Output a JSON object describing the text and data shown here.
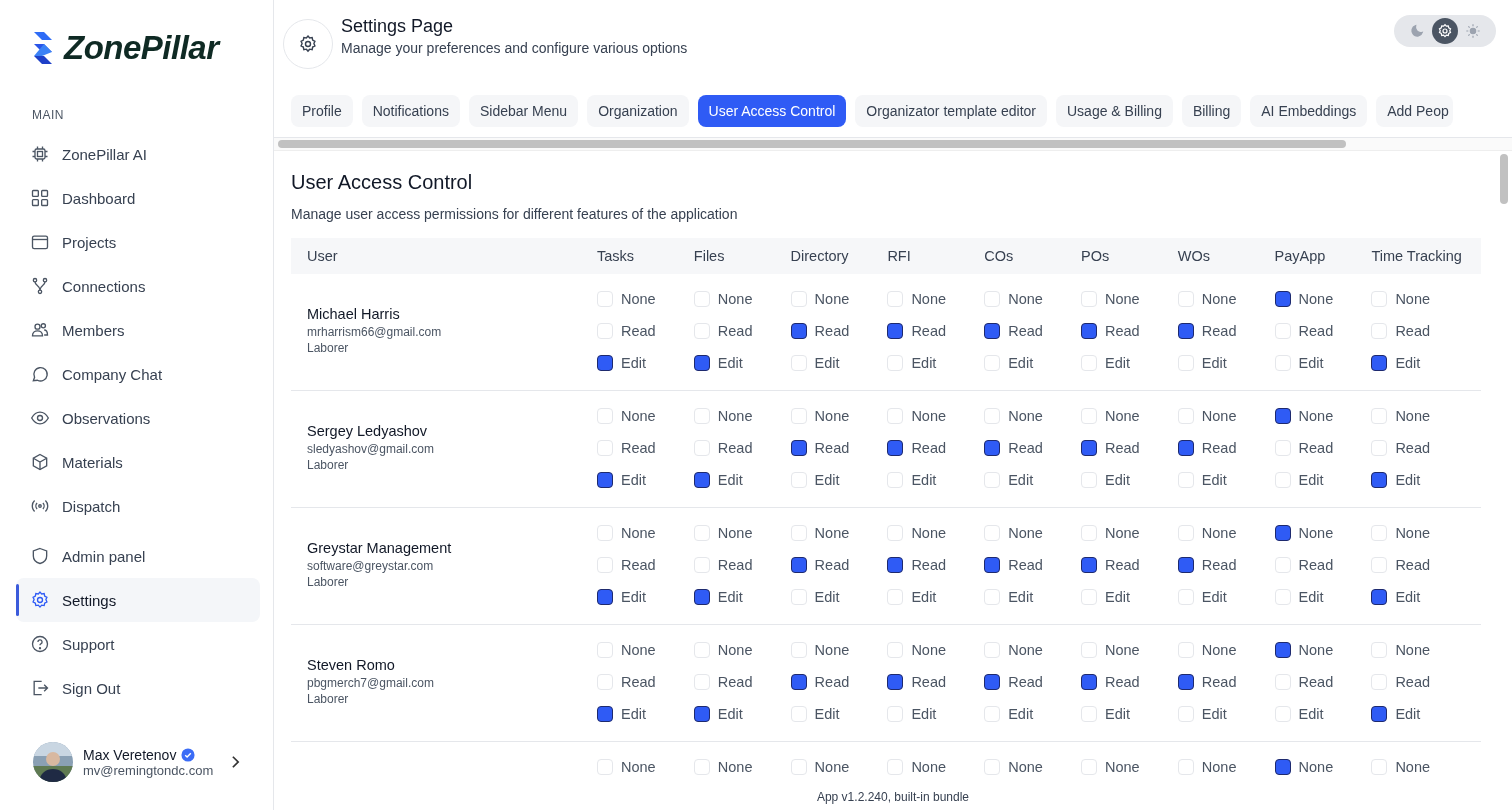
{
  "brand": {
    "name": "ZonePillar"
  },
  "sidebar": {
    "section_label": "MAIN",
    "items": [
      {
        "label": "ZonePillar AI",
        "selected": false
      },
      {
        "label": "Dashboard",
        "selected": false
      },
      {
        "label": "Projects",
        "selected": false
      },
      {
        "label": "Connections",
        "selected": false
      },
      {
        "label": "Members",
        "selected": false
      },
      {
        "label": "Company Chat",
        "selected": false
      },
      {
        "label": "Observations",
        "selected": false
      },
      {
        "label": "Materials",
        "selected": false
      },
      {
        "label": "Dispatch",
        "selected": false
      }
    ],
    "bottom_items": [
      {
        "label": "Admin panel",
        "selected": false
      },
      {
        "label": "Settings",
        "selected": true
      },
      {
        "label": "Support",
        "selected": false
      },
      {
        "label": "Sign Out",
        "selected": false
      }
    ],
    "user": {
      "name": "Max Veretenov",
      "email": "mv@remingtondc.com",
      "verified": true
    }
  },
  "header": {
    "title": "Settings Page",
    "subtitle": "Manage your preferences and configure various options"
  },
  "theme_modes": [
    {
      "kind": "dark",
      "selected": false
    },
    {
      "kind": "system",
      "selected": true
    },
    {
      "kind": "light",
      "selected": false
    }
  ],
  "tabs": [
    {
      "label": "Profile",
      "selected": false
    },
    {
      "label": "Notifications",
      "selected": false
    },
    {
      "label": "Sidebar Menu",
      "selected": false
    },
    {
      "label": "Organization",
      "selected": false
    },
    {
      "label": "User Access Control",
      "selected": true
    },
    {
      "label": "Organizator template editor",
      "selected": false
    },
    {
      "label": "Usage & Billing",
      "selected": false
    },
    {
      "label": "Billing",
      "selected": false
    },
    {
      "label": "AI Embeddings",
      "selected": false
    },
    {
      "label": "Add Peop",
      "selected": false
    }
  ],
  "section": {
    "title": "User Access Control",
    "description": "Manage user access permissions for different features of the application"
  },
  "table": {
    "user_column": "User",
    "columns": [
      "Tasks",
      "Files",
      "Directory",
      "RFI",
      "COs",
      "POs",
      "WOs",
      "PayApp",
      "Time Tracking"
    ],
    "rows": [
      {
        "name": "Michael Harris",
        "email": "mrharrism66@gmail.com",
        "role": "Laborer",
        "cells": [
          [
            {
              "label": "None",
              "checked": false
            },
            {
              "label": "Read",
              "checked": false
            },
            {
              "label": "Edit",
              "checked": true
            }
          ],
          [
            {
              "label": "None",
              "checked": false
            },
            {
              "label": "Read",
              "checked": false
            },
            {
              "label": "Edit",
              "checked": true
            }
          ],
          [
            {
              "label": "None",
              "checked": false
            },
            {
              "label": "Read",
              "checked": true
            },
            {
              "label": "Edit",
              "checked": false
            }
          ],
          [
            {
              "label": "None",
              "checked": false
            },
            {
              "label": "Read",
              "checked": true
            },
            {
              "label": "Edit",
              "checked": false
            }
          ],
          [
            {
              "label": "None",
              "checked": false
            },
            {
              "label": "Read",
              "checked": true
            },
            {
              "label": "Edit",
              "checked": false
            }
          ],
          [
            {
              "label": "None",
              "checked": false
            },
            {
              "label": "Read",
              "checked": true
            },
            {
              "label": "Edit",
              "checked": false
            }
          ],
          [
            {
              "label": "None",
              "checked": false
            },
            {
              "label": "Read",
              "checked": true
            },
            {
              "label": "Edit",
              "checked": false
            }
          ],
          [
            {
              "label": "None",
              "checked": true
            },
            {
              "label": "Read",
              "checked": false
            },
            {
              "label": "Edit",
              "checked": false
            }
          ],
          [
            {
              "label": "None",
              "checked": false
            },
            {
              "label": "Read",
              "checked": false
            },
            {
              "label": "Edit",
              "checked": true
            }
          ]
        ]
      },
      {
        "name": "Sergey Ledyashov",
        "email": "sledyashov@gmail.com",
        "role": "Laborer",
        "cells": [
          [
            {
              "label": "None",
              "checked": false
            },
            {
              "label": "Read",
              "checked": false
            },
            {
              "label": "Edit",
              "checked": true
            }
          ],
          [
            {
              "label": "None",
              "checked": false
            },
            {
              "label": "Read",
              "checked": false
            },
            {
              "label": "Edit",
              "checked": true
            }
          ],
          [
            {
              "label": "None",
              "checked": false
            },
            {
              "label": "Read",
              "checked": true
            },
            {
              "label": "Edit",
              "checked": false
            }
          ],
          [
            {
              "label": "None",
              "checked": false
            },
            {
              "label": "Read",
              "checked": true
            },
            {
              "label": "Edit",
              "checked": false
            }
          ],
          [
            {
              "label": "None",
              "checked": false
            },
            {
              "label": "Read",
              "checked": true
            },
            {
              "label": "Edit",
              "checked": false
            }
          ],
          [
            {
              "label": "None",
              "checked": false
            },
            {
              "label": "Read",
              "checked": true
            },
            {
              "label": "Edit",
              "checked": false
            }
          ],
          [
            {
              "label": "None",
              "checked": false
            },
            {
              "label": "Read",
              "checked": true
            },
            {
              "label": "Edit",
              "checked": false
            }
          ],
          [
            {
              "label": "None",
              "checked": true
            },
            {
              "label": "Read",
              "checked": false
            },
            {
              "label": "Edit",
              "checked": false
            }
          ],
          [
            {
              "label": "None",
              "checked": false
            },
            {
              "label": "Read",
              "checked": false
            },
            {
              "label": "Edit",
              "checked": true
            }
          ]
        ]
      },
      {
        "name": "Greystar Management",
        "email": "software@greystar.com",
        "role": "Laborer",
        "cells": [
          [
            {
              "label": "None",
              "checked": false
            },
            {
              "label": "Read",
              "checked": false
            },
            {
              "label": "Edit",
              "checked": true
            }
          ],
          [
            {
              "label": "None",
              "checked": false
            },
            {
              "label": "Read",
              "checked": false
            },
            {
              "label": "Edit",
              "checked": true
            }
          ],
          [
            {
              "label": "None",
              "checked": false
            },
            {
              "label": "Read",
              "checked": true
            },
            {
              "label": "Edit",
              "checked": false
            }
          ],
          [
            {
              "label": "None",
              "checked": false
            },
            {
              "label": "Read",
              "checked": true
            },
            {
              "label": "Edit",
              "checked": false
            }
          ],
          [
            {
              "label": "None",
              "checked": false
            },
            {
              "label": "Read",
              "checked": true
            },
            {
              "label": "Edit",
              "checked": false
            }
          ],
          [
            {
              "label": "None",
              "checked": false
            },
            {
              "label": "Read",
              "checked": true
            },
            {
              "label": "Edit",
              "checked": false
            }
          ],
          [
            {
              "label": "None",
              "checked": false
            },
            {
              "label": "Read",
              "checked": true
            },
            {
              "label": "Edit",
              "checked": false
            }
          ],
          [
            {
              "label": "None",
              "checked": true
            },
            {
              "label": "Read",
              "checked": false
            },
            {
              "label": "Edit",
              "checked": false
            }
          ],
          [
            {
              "label": "None",
              "checked": false
            },
            {
              "label": "Read",
              "checked": false
            },
            {
              "label": "Edit",
              "checked": true
            }
          ]
        ]
      },
      {
        "name": "Steven Romo",
        "email": "pbgmerch7@gmail.com",
        "role": "Laborer",
        "cells": [
          [
            {
              "label": "None",
              "checked": false
            },
            {
              "label": "Read",
              "checked": false
            },
            {
              "label": "Edit",
              "checked": true
            }
          ],
          [
            {
              "label": "None",
              "checked": false
            },
            {
              "label": "Read",
              "checked": false
            },
            {
              "label": "Edit",
              "checked": true
            }
          ],
          [
            {
              "label": "None",
              "checked": false
            },
            {
              "label": "Read",
              "checked": true
            },
            {
              "label": "Edit",
              "checked": false
            }
          ],
          [
            {
              "label": "None",
              "checked": false
            },
            {
              "label": "Read",
              "checked": true
            },
            {
              "label": "Edit",
              "checked": false
            }
          ],
          [
            {
              "label": "None",
              "checked": false
            },
            {
              "label": "Read",
              "checked": true
            },
            {
              "label": "Edit",
              "checked": false
            }
          ],
          [
            {
              "label": "None",
              "checked": false
            },
            {
              "label": "Read",
              "checked": true
            },
            {
              "label": "Edit",
              "checked": false
            }
          ],
          [
            {
              "label": "None",
              "checked": false
            },
            {
              "label": "Read",
              "checked": true
            },
            {
              "label": "Edit",
              "checked": false
            }
          ],
          [
            {
              "label": "None",
              "checked": true
            },
            {
              "label": "Read",
              "checked": false
            },
            {
              "label": "Edit",
              "checked": false
            }
          ],
          [
            {
              "label": "None",
              "checked": false
            },
            {
              "label": "Read",
              "checked": false
            },
            {
              "label": "Edit",
              "checked": true
            }
          ]
        ]
      },
      {
        "cells": [
          [
            {
              "label": "None",
              "checked": false
            }
          ],
          [
            {
              "label": "None",
              "checked": false
            }
          ],
          [
            {
              "label": "None",
              "checked": false
            }
          ],
          [
            {
              "label": "None",
              "checked": false
            }
          ],
          [
            {
              "label": "None",
              "checked": false
            }
          ],
          [
            {
              "label": "None",
              "checked": false
            }
          ],
          [
            {
              "label": "None",
              "checked": false
            }
          ],
          [
            {
              "label": "None",
              "checked": true
            }
          ],
          [
            {
              "label": "None",
              "checked": false
            }
          ]
        ]
      }
    ]
  },
  "footer": {
    "version": "App v1.2.240, built-in bundle"
  }
}
